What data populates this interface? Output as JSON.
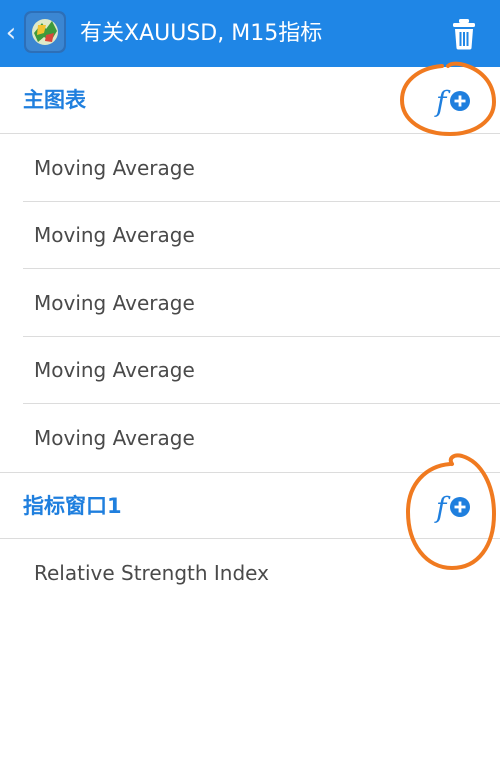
{
  "appbar": {
    "back_icon": "chevron-left-icon",
    "app_icon": "metatrader-logo-icon",
    "title": "有关XAUUSD, M15指标",
    "delete_icon": "trash-icon",
    "color": "#1f86e6"
  },
  "sections": [
    {
      "title": "主图表",
      "add_icon": "function-add-icon",
      "items": [
        "Moving Average",
        "Moving Average",
        "Moving Average",
        "Moving Average",
        "Moving Average"
      ]
    },
    {
      "title": "指标窗口1",
      "add_icon": "function-add-icon",
      "items": [
        "Relative Strength Index"
      ]
    }
  ],
  "colors": {
    "accent": "#1f7fde",
    "annotation": "#f07a20",
    "divider": "#dcdcdc"
  }
}
